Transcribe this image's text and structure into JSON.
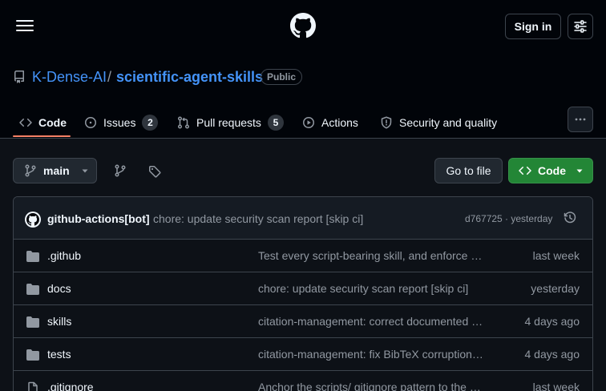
{
  "header": {
    "signin_label": "Sign in"
  },
  "repo": {
    "owner": "K-Dense-AI",
    "separator": "/",
    "name": "scientific-agent-skills",
    "visibility": "Public"
  },
  "tabs": [
    {
      "label": "Code",
      "icon": "code-icon",
      "active": true
    },
    {
      "label": "Issues",
      "icon": "issue-opened-icon",
      "count": "2"
    },
    {
      "label": "Pull requests",
      "icon": "git-pull-request-icon",
      "count": "5"
    },
    {
      "label": "Actions",
      "icon": "play-icon"
    },
    {
      "label": "Security and quality",
      "icon": "shield-icon"
    }
  ],
  "toolbar": {
    "branch": "main",
    "go_to_file": "Go to file",
    "code_button": "Code"
  },
  "latest_commit": {
    "author": "github-actions[bot]",
    "message": "chore: update security scan report [skip ci]",
    "meta": "d767725 · yesterday"
  },
  "files": [
    {
      "name": ".github",
      "type": "folder",
      "message": "Test every script-bearing skill, and enforce t…",
      "date": "last week"
    },
    {
      "name": "docs",
      "type": "folder",
      "message": "chore: update security scan report [skip ci]",
      "date": "yesterday"
    },
    {
      "name": "skills",
      "type": "folder",
      "message": "citation-management: correct documented …",
      "date": "4 days ago"
    },
    {
      "name": "tests",
      "type": "folder",
      "message": "citation-management: fix BibTeX corruption…",
      "date": "4 days ago"
    },
    {
      "name": ".gitignore",
      "type": "file",
      "message": "Anchor the scripts/ gitignore pattern to the …",
      "date": "last week"
    }
  ],
  "colors": {
    "accent_link": "#4493f8",
    "primary_button": "#238636",
    "active_tab_underline": "#f78166",
    "folder_icon": "#9198a1"
  }
}
